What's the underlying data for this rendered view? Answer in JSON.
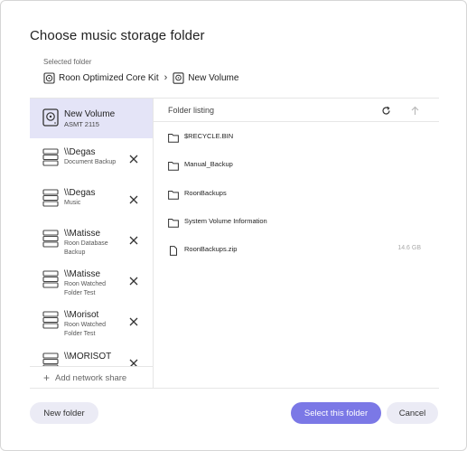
{
  "dialog": {
    "title": "Choose music storage folder",
    "selected_folder_label": "Selected folder",
    "breadcrumb": [
      {
        "label": "Roon Optimized Core Kit",
        "icon": "core-icon"
      },
      {
        "label": "New Volume",
        "icon": "drive-icon"
      }
    ],
    "breadcrumb_separator": "›"
  },
  "sidebar": {
    "volume": {
      "name": "New Volume",
      "sub": "ASMT 2115",
      "icon": "drive-icon"
    },
    "shares": [
      {
        "name": "\\\\Degas",
        "sub": "Document Backup"
      },
      {
        "name": "\\\\Degas",
        "sub": "Music"
      },
      {
        "name": "\\\\Matisse",
        "sub": "Roon Database Backup"
      },
      {
        "name": "\\\\Matisse",
        "sub": "Roon Watched Folder Test"
      },
      {
        "name": "\\\\Morisot",
        "sub": "Roon Watched Folder Test"
      },
      {
        "name": "\\\\MORISOT",
        "sub": ""
      }
    ],
    "add_share": "Add network share"
  },
  "listing": {
    "header": "Folder listing",
    "items": [
      {
        "name": "$RECYCLE.BIN",
        "type": "folder",
        "size": ""
      },
      {
        "name": "Manual_Backup",
        "type": "folder",
        "size": ""
      },
      {
        "name": "RoonBackups",
        "type": "folder",
        "size": ""
      },
      {
        "name": "System Volume Information",
        "type": "folder",
        "size": ""
      },
      {
        "name": "RoonBackups.zip",
        "type": "file",
        "size": "14.6 GB"
      }
    ]
  },
  "buttons": {
    "new_folder": "New folder",
    "select": "Select this folder",
    "cancel": "Cancel"
  },
  "colors": {
    "accent": "#7b78e6",
    "selected_row": "#e4e4f7",
    "secondary_button": "#ebebf5"
  }
}
